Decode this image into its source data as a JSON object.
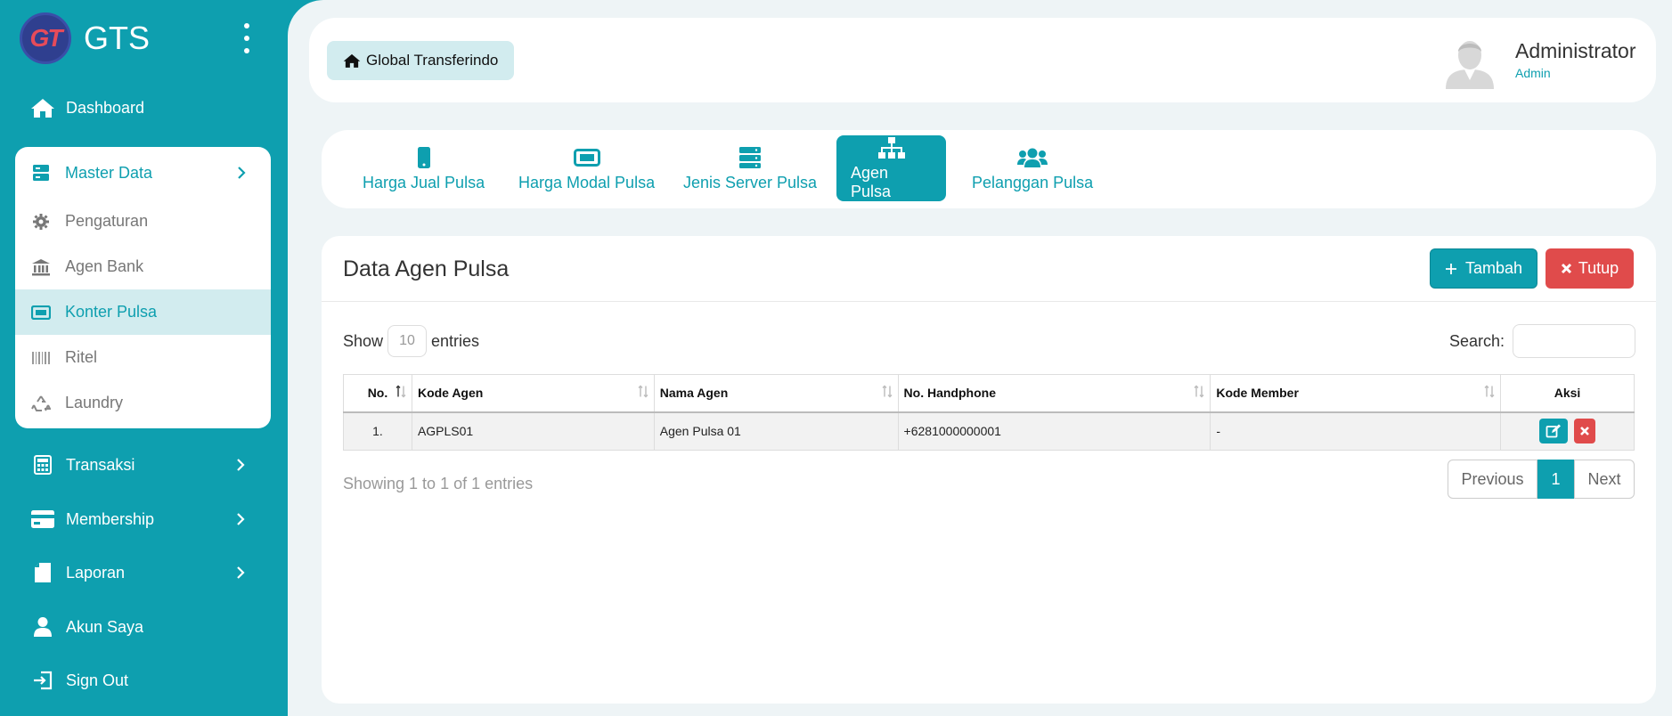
{
  "brand": {
    "logo_text": "GT",
    "name": "GTS"
  },
  "sidebar": {
    "dashboard": "Dashboard",
    "master": {
      "label": "Master Data",
      "items": [
        {
          "label": "Pengaturan",
          "icon": "gear-icon"
        },
        {
          "label": "Agen Bank",
          "icon": "bank-icon"
        },
        {
          "label": "Konter Pulsa",
          "icon": "ticket-icon",
          "active": true
        },
        {
          "label": "Ritel",
          "icon": "barcode-icon"
        },
        {
          "label": "Laundry",
          "icon": "recycle-icon"
        }
      ]
    },
    "transaksi": "Transaksi",
    "membership": "Membership",
    "laporan": "Laporan",
    "akun": "Akun Saya",
    "signout": "Sign Out"
  },
  "topbar": {
    "home_label": "Global Transferindo",
    "user_name": "Administrator",
    "user_role": "Admin"
  },
  "tabs": [
    {
      "label": "Harga Jual Pulsa",
      "icon": "mobile-icon"
    },
    {
      "label": "Harga Modal Pulsa",
      "icon": "ticket-icon"
    },
    {
      "label": "Jenis Server Pulsa",
      "icon": "server-icon"
    },
    {
      "label": "Agen Pulsa",
      "icon": "sitemap-icon",
      "active": true
    },
    {
      "label": "Pelanggan Pulsa",
      "icon": "users-icon"
    }
  ],
  "card": {
    "title": "Data Agen Pulsa",
    "add_label": "Tambah",
    "close_label": "Tutup",
    "show_label": "Show",
    "entries_value": "10",
    "entries_label": "entries",
    "search_label": "Search:",
    "search_value": ""
  },
  "table": {
    "headers": [
      "No.",
      "Kode Agen",
      "Nama Agen",
      "No. Handphone",
      "Kode Member",
      "Aksi"
    ],
    "rows": [
      {
        "no": "1.",
        "kode_agen": "AGPLS01",
        "nama_agen": "Agen Pulsa 01",
        "handphone": "+6281000000001",
        "kode_member": "-"
      }
    ]
  },
  "footer": {
    "info": "Showing 1 to 1 of 1 entries",
    "previous": "Previous",
    "page": "1",
    "next": "Next"
  },
  "colors": {
    "primary": "#0e9faf",
    "danger": "#e04b4b",
    "active_bg": "#d2ecef"
  }
}
